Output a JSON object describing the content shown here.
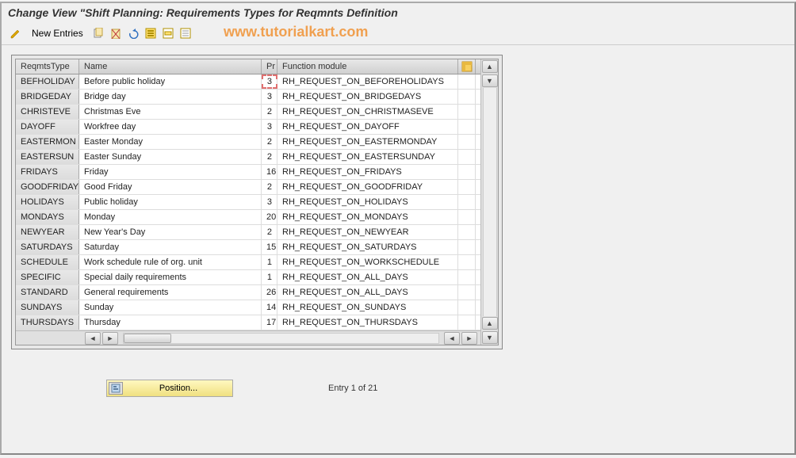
{
  "title": "Change View \"Shift Planning: Requirements Types for Reqmnts Definition",
  "watermark": "www.tutorialkart.com",
  "toolbar": {
    "new_entries": "New Entries"
  },
  "columns": {
    "type": "ReqmtsType",
    "name": "Name",
    "pr": "Pr",
    "fm": "Function module"
  },
  "rows": [
    {
      "type": "BEFHOLIDAY",
      "name": "Before public holiday",
      "pr": "3",
      "fm": "RH_REQUEST_ON_BEFOREHOLIDAYS"
    },
    {
      "type": "BRIDGEDAY",
      "name": "Bridge day",
      "pr": "3",
      "fm": "RH_REQUEST_ON_BRIDGEDAYS"
    },
    {
      "type": "CHRISTEVE",
      "name": "Christmas Eve",
      "pr": "2",
      "fm": "RH_REQUEST_ON_CHRISTMASEVE"
    },
    {
      "type": "DAYOFF",
      "name": "Workfree day",
      "pr": "3",
      "fm": "RH_REQUEST_ON_DAYOFF"
    },
    {
      "type": "EASTERMON",
      "name": "Easter Monday",
      "pr": "2",
      "fm": "RH_REQUEST_ON_EASTERMONDAY"
    },
    {
      "type": "EASTERSUN",
      "name": "Easter Sunday",
      "pr": "2",
      "fm": "RH_REQUEST_ON_EASTERSUNDAY"
    },
    {
      "type": "FRIDAYS",
      "name": "Friday",
      "pr": "16",
      "fm": "RH_REQUEST_ON_FRIDAYS"
    },
    {
      "type": "GOODFRIDAY",
      "name": "Good Friday",
      "pr": "2",
      "fm": "RH_REQUEST_ON_GOODFRIDAY"
    },
    {
      "type": "HOLIDAYS",
      "name": "Public holiday",
      "pr": "3",
      "fm": "RH_REQUEST_ON_HOLIDAYS"
    },
    {
      "type": "MONDAYS",
      "name": "Monday",
      "pr": "20",
      "fm": "RH_REQUEST_ON_MONDAYS"
    },
    {
      "type": "NEWYEAR",
      "name": "New Year's Day",
      "pr": "2",
      "fm": "RH_REQUEST_ON_NEWYEAR"
    },
    {
      "type": "SATURDAYS",
      "name": "Saturday",
      "pr": "15",
      "fm": "RH_REQUEST_ON_SATURDAYS"
    },
    {
      "type": "SCHEDULE",
      "name": "Work schedule rule of org. unit",
      "pr": "1",
      "fm": "RH_REQUEST_ON_WORKSCHEDULE"
    },
    {
      "type": "SPECIFIC",
      "name": "Special daily requirements",
      "pr": "1",
      "fm": "RH_REQUEST_ON_ALL_DAYS"
    },
    {
      "type": "STANDARD",
      "name": "General requirements",
      "pr": "26",
      "fm": "RH_REQUEST_ON_ALL_DAYS"
    },
    {
      "type": "SUNDAYS",
      "name": "Sunday",
      "pr": "14",
      "fm": "RH_REQUEST_ON_SUNDAYS"
    },
    {
      "type": "THURSDAYS",
      "name": "Thursday",
      "pr": "17",
      "fm": "RH_REQUEST_ON_THURSDAYS"
    }
  ],
  "footer": {
    "position_label": "Position...",
    "entry_label": "Entry 1 of 21"
  }
}
